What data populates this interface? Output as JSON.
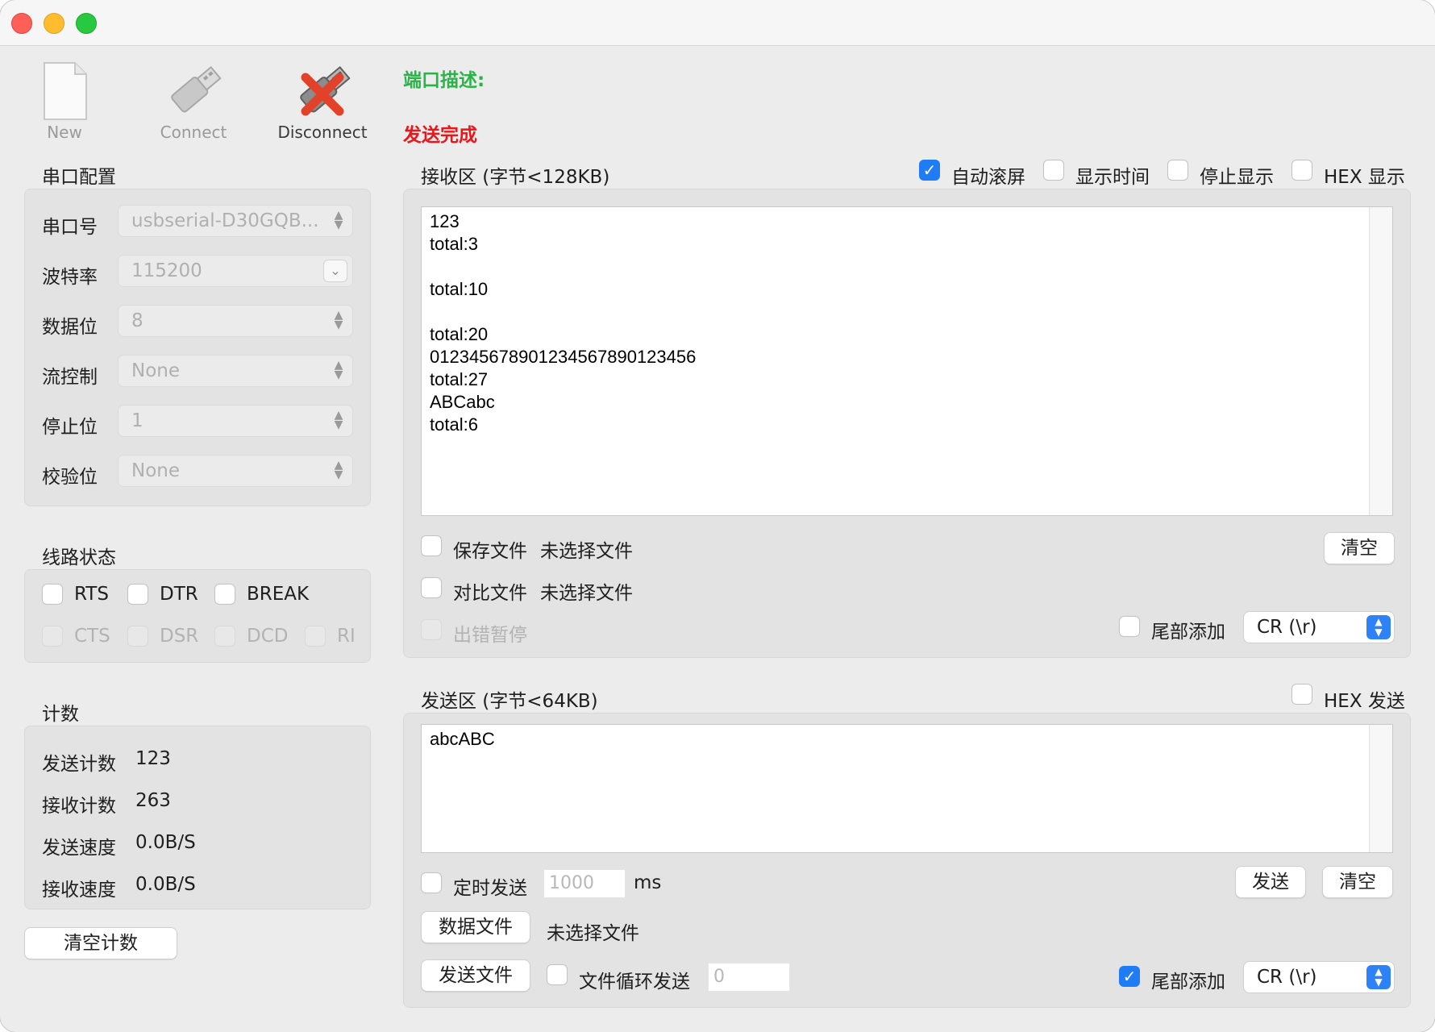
{
  "toolbar": {
    "new_label": "New",
    "connect_label": "Connect",
    "disconnect_label": "Disconnect"
  },
  "status": {
    "port_description": "端口描述:",
    "send_status": "发送完成"
  },
  "serial_config": {
    "title": "串口配置",
    "rows": [
      {
        "label": "串口号",
        "value": "usbserial-D30GQB..."
      },
      {
        "label": "波特率",
        "value": "115200"
      },
      {
        "label": "数据位",
        "value": "8"
      },
      {
        "label": "流控制",
        "value": "None"
      },
      {
        "label": "停止位",
        "value": "1"
      },
      {
        "label": "校验位",
        "value": "None"
      }
    ]
  },
  "line_status": {
    "title": "线路状态",
    "outputs": [
      "RTS",
      "DTR",
      "BREAK"
    ],
    "inputs": [
      "CTS",
      "DSR",
      "DCD",
      "RI"
    ]
  },
  "counts": {
    "title": "计数",
    "send_count_label": "发送计数",
    "send_count": "123",
    "recv_count_label": "接收计数",
    "recv_count": "263",
    "send_speed_label": "发送速度",
    "send_speed": "0.0B/S",
    "recv_speed_label": "接收速度",
    "recv_speed": "0.0B/S",
    "clear_label": "清空计数"
  },
  "receive": {
    "title": "接收区 (字节<128KB)",
    "auto_scroll": "自动滚屏",
    "show_time": "显示时间",
    "stop_display": "停止显示",
    "hex_display": "HEX 显示",
    "content": "123\ntotal:3\n\ntotal:10\n\ntotal:20\n012345678901234567890123456\ntotal:27\nABCabc\ntotal:6",
    "save_file": "保存文件",
    "save_file_name": "未选择文件",
    "compare_file": "对比文件",
    "compare_file_name": "未选择文件",
    "pause_on_error": "出错暂停",
    "clear_label": "清空",
    "append_tail": "尾部添加",
    "tail_option": "CR (\\r)"
  },
  "send": {
    "title": "发送区 (字节<64KB)",
    "hex_send": "HEX 发送",
    "content": "abcABC",
    "timed_send": "定时发送",
    "interval_placeholder": "1000",
    "interval_unit": "ms",
    "send_label": "发送",
    "clear_label": "清空",
    "data_file_label": "数据文件",
    "data_file_name": "未选择文件",
    "send_file_label": "发送文件",
    "loop_send": "文件循环发送",
    "loop_placeholder": "0",
    "append_tail": "尾部添加",
    "tail_option": "CR (\\r)"
  },
  "colors": {
    "status_green": "#2bb34a",
    "status_red": "#e8171c",
    "accent_blue": "#1f7cf5"
  }
}
